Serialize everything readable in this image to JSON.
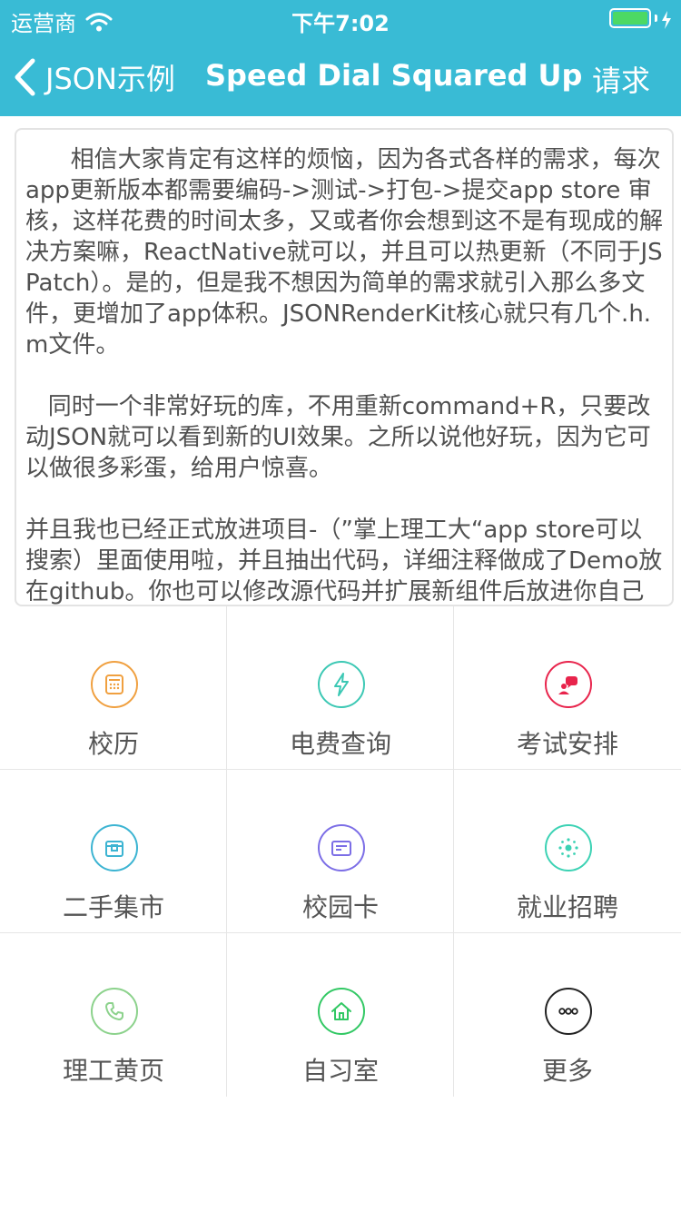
{
  "status_bar": {
    "carrier": "运营商",
    "time": "下午7:02",
    "battery_level": 1.0
  },
  "nav": {
    "back_label": "JSON示例",
    "title": "Speed Dial Squared Up",
    "right_button": "请求"
  },
  "content": {
    "text": "      相信大家肯定有这样的烦恼，因为各式各样的需求，每次app更新版本都需要编码->测试->打包->提交app store 审核，这样花费的时间太多，又或者你会想到这不是有现成的解决方案嘛，ReactNative就可以，并且可以热更新（不同于JSPatch）。是的，但是我不想因为简单的需求就引入那么多文件，更增加了app体积。JSONRenderKit核心就只有几个.h.m文件。\n\n   同时一个非常好玩的库，不用重新command+R，只要改动JSON就可以看到新的UI效果。之所以说他好玩，因为它可以做很多彩蛋，给用户惊喜。\n\n并且我也已经正式放进项目-（”掌上理工大“app store可以搜索）里面使用啦，并且抽出代码，详细注释做成了Demo放在github。你也可以修改源代码并扩展新组件后放进你自己的项目，重要的是你也可以参考"
  },
  "grid": {
    "items": [
      {
        "label": "校历",
        "icon": "calendar-icon",
        "color": "#f0a040"
      },
      {
        "label": "电费查询",
        "icon": "lightning-icon",
        "color": "#3cc8b4"
      },
      {
        "label": "考试安排",
        "icon": "chat-people-icon",
        "color": "#e8244c"
      },
      {
        "label": "二手集市",
        "icon": "treasure-box-icon",
        "color": "#3cb4d2"
      },
      {
        "label": "校园卡",
        "icon": "card-icon",
        "color": "#7c6ee6"
      },
      {
        "label": "就业招聘",
        "icon": "network-icon",
        "color": "#3cd2b4"
      },
      {
        "label": "理工黄页",
        "icon": "phone-icon",
        "color": "#8cd28c"
      },
      {
        "label": "自习室",
        "icon": "home-icon",
        "color": "#32c864"
      },
      {
        "label": "更多",
        "icon": "more-icon",
        "color": "#222222"
      }
    ]
  }
}
